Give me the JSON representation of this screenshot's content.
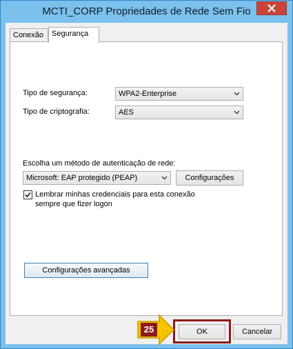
{
  "window": {
    "title": "MCTI_CORP Propriedades de Rede Sem Fio"
  },
  "tabs": [
    {
      "label": "Conexão",
      "active": false
    },
    {
      "label": "Segurança",
      "active": true
    }
  ],
  "security": {
    "type_label": "Tipo de segurança:",
    "type_value": "WPA2-Enterprise",
    "encryption_label": "Tipo de criptografia:",
    "encryption_value": "AES",
    "auth_method_label": "Escolha um método de autenticação de rede:",
    "auth_method_value": "Microsoft: EAP protegido (PEAP)",
    "settings_button": "Configurações",
    "remember_checkbox_checked": true,
    "remember_line1": "Lembrar minhas credenciais para esta conexão",
    "remember_line2": "sempre que fizer logon",
    "advanced_button": "Configurações avançadas"
  },
  "footer": {
    "ok_label": "OK",
    "cancel_label": "Cancelar"
  },
  "annotation": {
    "step_number": "25",
    "arrow_color": "#f5c400",
    "badge_color": "#8b1a1a"
  }
}
